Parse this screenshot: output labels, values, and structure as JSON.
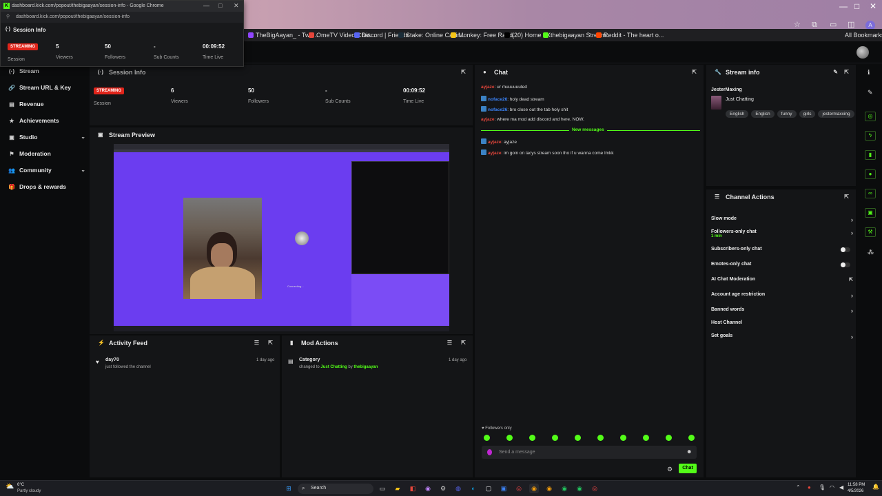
{
  "browser": {
    "bookmarks": [
      {
        "label": "TheBigAayan_ - Twit...",
        "color": "#9146ff"
      },
      {
        "label": "OmeTV Video Chat...",
        "color": "#e5463b"
      },
      {
        "label": "Discord | Friends",
        "color": "#5865f2"
      },
      {
        "label": "Stake: Online Casin...",
        "color": "#1a2c38"
      },
      {
        "label": "Monkey: Free Rand...",
        "color": "#f5c518"
      },
      {
        "label": "(20) Home / X",
        "color": "#000000"
      },
      {
        "label": "thebigaayan Stream...",
        "color": "#53fc18"
      },
      {
        "label": "Reddit - The heart o...",
        "color": "#ff4500"
      }
    ],
    "all_bookmarks": "All Bookmarks"
  },
  "popout": {
    "title": "dashboard.kick.com/popout/thebigaayan/session-info - Google Chrome",
    "url": "dashboard.kick.com/popout/thebigaayan/session-info",
    "header": "Session Info",
    "badge": "STREAMING",
    "session_label": "Session",
    "stats": [
      {
        "value": "5",
        "label": "Viewers"
      },
      {
        "value": "50",
        "label": "Followers"
      },
      {
        "value": "-",
        "label": "Sub Counts"
      },
      {
        "value": "00:09:52",
        "label": "Time Live"
      }
    ]
  },
  "sidebar": {
    "items": [
      {
        "label": "Stream",
        "icon": "(·)"
      },
      {
        "label": "Stream URL & Key",
        "icon": "🔗"
      },
      {
        "label": "Revenue",
        "icon": "▤"
      },
      {
        "label": "Achievements",
        "icon": "★"
      },
      {
        "label": "Studio",
        "icon": "▣"
      },
      {
        "label": "Moderation",
        "icon": "⚑"
      },
      {
        "label": "Community",
        "icon": "👥"
      },
      {
        "label": "Drops & rewards",
        "icon": "🎁"
      }
    ]
  },
  "session_info": {
    "title": "Session Info",
    "badge": "STREAMING",
    "session_label": "Session",
    "stats": [
      {
        "value": "6",
        "label": "Viewers"
      },
      {
        "value": "50",
        "label": "Followers"
      },
      {
        "value": "-",
        "label": "Sub Counts"
      },
      {
        "value": "00:09:52",
        "label": "Time Live"
      }
    ]
  },
  "preview": {
    "title": "Stream Preview",
    "connecting": "Connecting..."
  },
  "activity": {
    "title": "Activity Feed",
    "items": [
      {
        "user": "day70",
        "text": "just followed the channel",
        "time": "1 day ago"
      }
    ]
  },
  "mod_actions": {
    "title": "Mod Actions",
    "items": [
      {
        "type": "Category",
        "prefix": "changed to",
        "category": "Just Chatting",
        "by": "by",
        "user": "thebigaayan",
        "time": "1 day ago"
      }
    ]
  },
  "chat": {
    "title": "Chat",
    "messages": [
      {
        "user": "ayjaze",
        "text": ": ur muuuuuuted",
        "color": "#e5463b",
        "badge": false
      },
      {
        "user": "noface26",
        "text": ": holy dead stream",
        "color": "#3b82f6",
        "badge": true
      },
      {
        "user": "noface26",
        "text": ": bro close out the tab holy shit",
        "color": "#3b82f6",
        "badge": true
      },
      {
        "user": "ayjaze",
        "text": ": where ma mod add discord and here. NOW.",
        "color": "#e5463b",
        "badge": false
      }
    ],
    "new_messages": "New messages",
    "new": [
      {
        "user": "ayjaze",
        "text": ": ayjaze",
        "color": "#e5463b",
        "badge": true
      },
      {
        "user": "ayjaze",
        "text": ": im goin on lacys stream soon tho if u wanna come lmkk",
        "color": "#e5463b",
        "badge": true
      }
    ],
    "followers_only": "Followers only",
    "placeholder": "Send a message",
    "send": "Chat"
  },
  "stream_info": {
    "title": "Stream info",
    "streamer": "JesterMaxing",
    "category": "Just Chatting",
    "tags": [
      "English",
      "English",
      "funny",
      "girls",
      "jestermaxxing"
    ]
  },
  "channel_actions": {
    "title": "Channel Actions",
    "items": [
      {
        "label": "Slow mode",
        "control": "chevron"
      },
      {
        "label": "Followers-only chat",
        "sub": "1 min",
        "control": "chevron"
      },
      {
        "label": "Subscribers-only chat",
        "control": "toggle"
      },
      {
        "label": "Emotes-only chat",
        "control": "toggle"
      },
      {
        "label": "AI Chat Moderation",
        "control": "external"
      },
      {
        "label": "Account age restriction",
        "control": "chevron"
      },
      {
        "label": "Banned words",
        "control": "chevron"
      },
      {
        "label": "Host Channel",
        "control": "none"
      },
      {
        "label": "Set goals",
        "control": "chevron"
      }
    ]
  },
  "taskbar": {
    "weather_temp": "6°C",
    "weather_text": "Partly cloudy",
    "search": "Search",
    "time": "11:58 PM",
    "date": "4/5/2026"
  },
  "colors": {
    "accent": "#53fc18",
    "live": "#e1251b",
    "panel": "#141517"
  }
}
